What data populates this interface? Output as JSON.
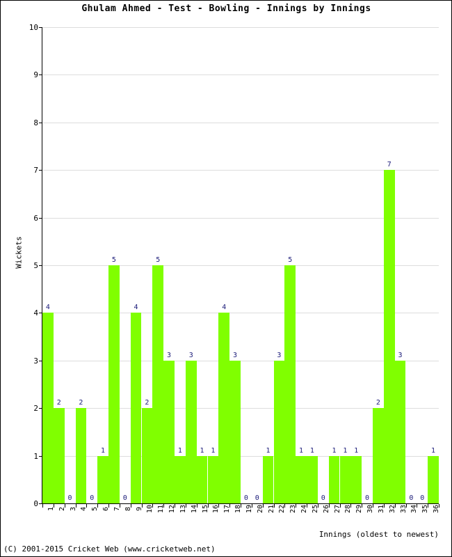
{
  "chart_data": {
    "type": "bar",
    "title": "Ghulam Ahmed - Test - Bowling - Innings by Innings",
    "xlabel": "Innings (oldest to newest)",
    "ylabel": "Wickets",
    "ylim": [
      0,
      10
    ],
    "ytick_step": 1,
    "grid": true,
    "legend": null,
    "bar_color": "#80ff00",
    "value_label_color": "#1a1a78",
    "gridline_color": "#dddddd",
    "axis_color": "#000000",
    "show_value_labels": true,
    "categories": [
      "1",
      "2",
      "3",
      "4",
      "5",
      "6",
      "7",
      "8",
      "9",
      "10",
      "11",
      "12",
      "13",
      "14",
      "15",
      "16",
      "17",
      "18",
      "19",
      "20",
      "21",
      "22",
      "23",
      "24",
      "25",
      "26",
      "27",
      "28",
      "29",
      "30",
      "31",
      "32",
      "33",
      "34",
      "35",
      "36"
    ],
    "values": [
      4,
      2,
      0,
      2,
      0,
      1,
      5,
      0,
      4,
      2,
      5,
      3,
      1,
      3,
      1,
      1,
      4,
      3,
      0,
      0,
      1,
      3,
      5,
      1,
      1,
      0,
      1,
      1,
      1,
      0,
      2,
      7,
      3,
      0,
      0,
      1
    ],
    "ytick_labels": [
      "0",
      "1",
      "2",
      "3",
      "4",
      "5",
      "6",
      "7",
      "8",
      "9",
      "10"
    ]
  },
  "footer": {
    "copyright": "(C) 2001-2015 Cricket Web (www.cricketweb.net)"
  }
}
